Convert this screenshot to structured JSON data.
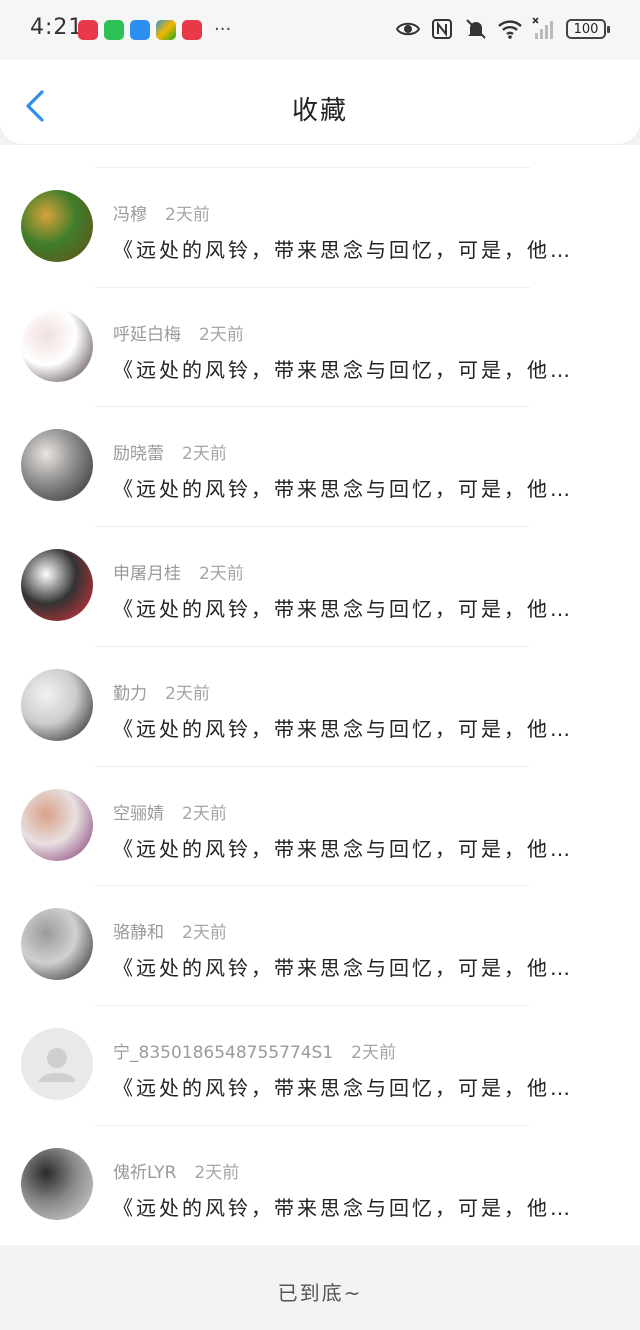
{
  "status_bar": {
    "time": "4:21",
    "more": "···",
    "battery": "100"
  },
  "header": {
    "title": "收藏"
  },
  "items": [
    {
      "name": "冯穆",
      "time": "2天前",
      "content": "《远处的风铃，带来思念与回忆，可是，他…",
      "avatar_colors": [
        "#6b4a1a",
        "#d8a23a",
        "#3e7d2a"
      ]
    },
    {
      "name": "呼延白梅",
      "time": "2天前",
      "content": "《远处的风铃，带来思念与回忆，可是，他…",
      "avatar_colors": [
        "#3a2a2a",
        "#f0e0dc",
        "#ffffff"
      ]
    },
    {
      "name": "励晓蕾",
      "time": "2天前",
      "content": "《远处的风铃，带来思念与回忆，可是，他…",
      "avatar_colors": [
        "#2a2a2a",
        "#e9e4df",
        "#8b8b8b"
      ]
    },
    {
      "name": "申屠月桂",
      "time": "2天前",
      "content": "《远处的风铃，带来思念与回忆，可是，他…",
      "avatar_colors": [
        "#e4323a",
        "#ffffff",
        "#333333"
      ]
    },
    {
      "name": "勤力",
      "time": "2天前",
      "content": "《远处的风铃，带来思念与回忆，可是，他…",
      "avatar_colors": [
        "#111111",
        "#f2f2f2",
        "#cccccc"
      ]
    },
    {
      "name": "空骊婧",
      "time": "2天前",
      "content": "《远处的风铃，带来思念与回忆，可是，他…",
      "avatar_colors": [
        "#7a2a6a",
        "#d9a088",
        "#e8e0e0"
      ]
    },
    {
      "name": "骆静和",
      "time": "2天前",
      "content": "《远处的风铃，带来思念与回忆，可是，他…",
      "avatar_colors": [
        "#1a1a1a",
        "#9a9a9a",
        "#d0d0d0"
      ]
    },
    {
      "name": "宁_8350186548755774S1",
      "time": "2天前",
      "content": "《远处的风铃，带来思念与回忆，可是，他…",
      "avatar_colors": [
        "#e9e9e9",
        "#cfcfcf",
        "#cfcfcf"
      ],
      "placeholder": true
    },
    {
      "name": "傀祈LYR",
      "time": "2天前",
      "content": "《远处的风铃，带来思念与回忆，可是，他…",
      "avatar_colors": [
        "#d8d8d8",
        "#2a2a2a",
        "#8a8a8a"
      ]
    }
  ],
  "footer": {
    "text": "已到底~"
  },
  "colors": {
    "accent": "#2f8fe8",
    "name_gray": "#9a9a9a"
  }
}
